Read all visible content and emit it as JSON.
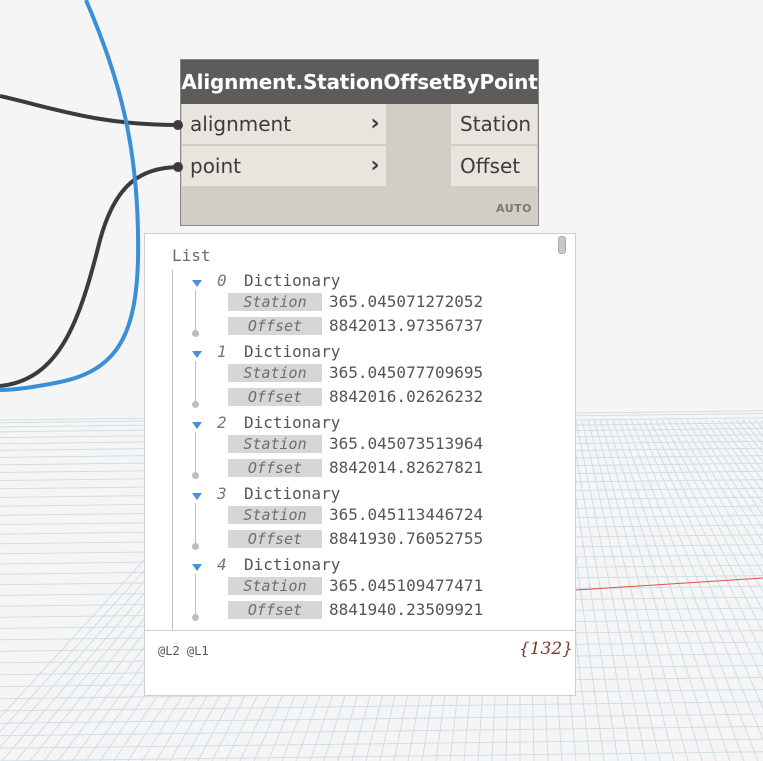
{
  "node": {
    "title": "Alignment.StationOffsetByPoint",
    "inputs": [
      {
        "label": "alignment",
        "chevron": "›"
      },
      {
        "label": "point",
        "chevron": "›"
      }
    ],
    "outputs": [
      {
        "label": "Station"
      },
      {
        "label": "Offset"
      }
    ],
    "lacing": "AUTO"
  },
  "preview": {
    "list_label": "List",
    "items": [
      {
        "index": "0",
        "type": "Dictionary",
        "station_key": "Station",
        "station": "365.045071272052",
        "offset_key": "Offset",
        "offset": "8842013.97356737"
      },
      {
        "index": "1",
        "type": "Dictionary",
        "station_key": "Station",
        "station": "365.045077709695",
        "offset_key": "Offset",
        "offset": "8842016.02626232"
      },
      {
        "index": "2",
        "type": "Dictionary",
        "station_key": "Station",
        "station": "365.045073513964",
        "offset_key": "Offset",
        "offset": "8842014.82627821"
      },
      {
        "index": "3",
        "type": "Dictionary",
        "station_key": "Station",
        "station": "365.045113446724",
        "offset_key": "Offset",
        "offset": "8841930.76052755"
      },
      {
        "index": "4",
        "type": "Dictionary",
        "station_key": "Station",
        "station": "365.045109477471",
        "offset_key": "Offset",
        "offset": "8841940.23509921"
      }
    ],
    "levels": "@L2 @L1",
    "count": "{132}"
  },
  "colors": {
    "wire_dark": "#3b3b3b",
    "wire_blue": "#3b8fd6",
    "node_header": "#5e5c5a",
    "node_body": "#d2cdc5",
    "port_bg": "#e8e5df",
    "grid_line": "#cfdde6",
    "axis_red": "#e05050"
  }
}
